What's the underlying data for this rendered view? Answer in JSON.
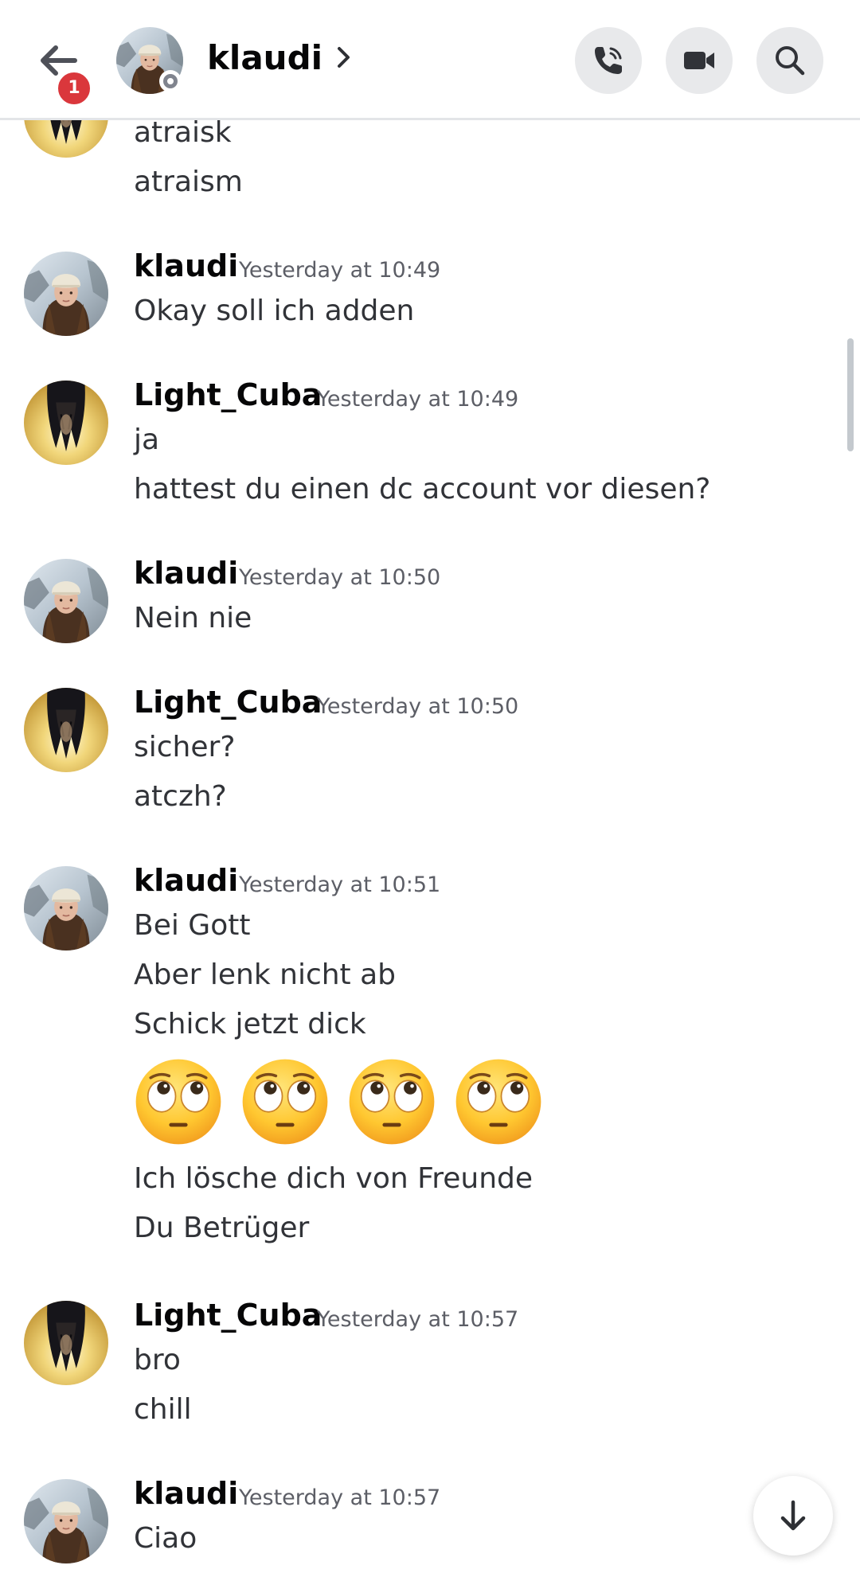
{
  "header": {
    "unread_badge": "1",
    "channel_name": "klaudi",
    "status": "offline"
  },
  "messages": [
    {
      "lines": [
        "atraisk",
        "atraism"
      ]
    },
    {
      "author": "klaudi",
      "timestamp": "Yesterday at 10:49",
      "lines": [
        "Okay soll ich adden"
      ]
    },
    {
      "author": "Light_Cuba",
      "timestamp": "Yesterday at 10:49",
      "lines": [
        "ja",
        "hattest du einen dc account vor diesen?"
      ]
    },
    {
      "author": "klaudi",
      "timestamp": "Yesterday at 10:50",
      "lines": [
        "Nein nie"
      ]
    },
    {
      "author": "Light_Cuba",
      "timestamp": "Yesterday at 10:50",
      "lines": [
        "sicher?",
        "atczh?"
      ]
    },
    {
      "author": "klaudi",
      "timestamp": "Yesterday at 10:51",
      "lines": [
        "Bei Gott",
        "Aber lenk nicht ab",
        "Schick jetzt dick",
        "Ich lösche dich von Freunde",
        "Du Betrüger"
      ],
      "emojis": [
        "face-with-rolling-eyes",
        "face-with-rolling-eyes",
        "face-with-rolling-eyes",
        "face-with-rolling-eyes"
      ]
    },
    {
      "author": "Light_Cuba",
      "timestamp": "Yesterday at 10:57",
      "lines": [
        "bro",
        "chill"
      ]
    },
    {
      "author": "klaudi",
      "timestamp": "Yesterday at 10:57",
      "lines": [
        "Ciao"
      ]
    }
  ],
  "icons": {
    "back": "arrow-left-icon",
    "call": "phone-call-icon",
    "video": "video-camera-icon",
    "search": "search-icon",
    "jump": "arrow-down-icon"
  },
  "colors": {
    "badge": "#da373c",
    "status_offline": "#80848e",
    "icon_button_bg": "#e8e9eb"
  }
}
